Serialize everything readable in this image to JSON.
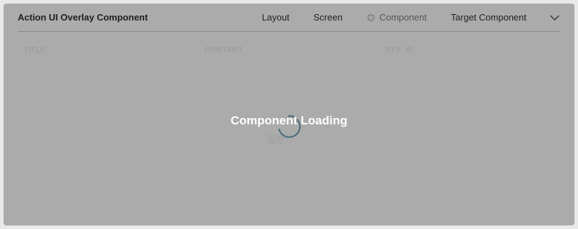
{
  "panel": {
    "title": "Action UI Overlay Component",
    "tabs": [
      {
        "label": "Layout"
      },
      {
        "label": "Screen"
      },
      {
        "label": "Component",
        "icon": "spinner-icon"
      },
      {
        "label": "Target Component"
      }
    ],
    "menu_icon": "chevron-down-icon"
  },
  "table": {
    "columns": [
      "TITLE",
      "CONTENT",
      "SYS_ID"
    ]
  },
  "loading": {
    "text": "Component Loading",
    "background_text": "일반"
  },
  "colors": {
    "panel_bg": "#ababab",
    "spinner_accent": "#4f6f7f",
    "header_rule": "#7f8c96"
  }
}
